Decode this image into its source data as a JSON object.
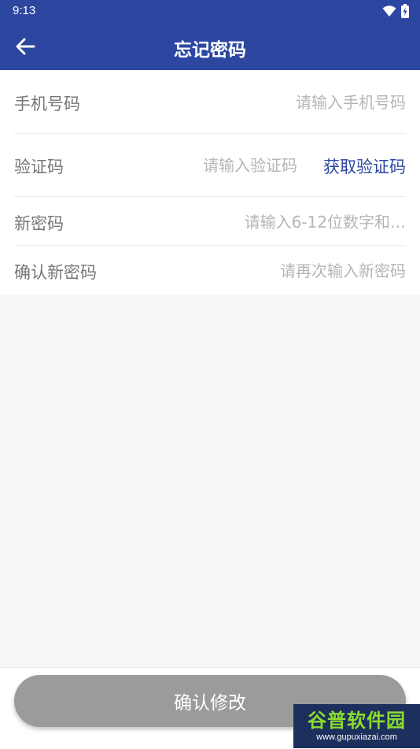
{
  "status_bar": {
    "time": "9:13"
  },
  "header": {
    "title": "忘记密码"
  },
  "form": {
    "phone": {
      "label": "手机号码",
      "placeholder": "请输入手机号码",
      "value": ""
    },
    "code": {
      "label": "验证码",
      "placeholder": "请输入验证码",
      "value": "",
      "get_code_label": "获取验证码"
    },
    "new_password": {
      "label": "新密码",
      "placeholder": "请输入6-12位数字和…",
      "value": ""
    },
    "confirm_password": {
      "label": "确认新密码",
      "placeholder": "请再次输入新密码",
      "value": ""
    }
  },
  "submit": {
    "label": "确认修改"
  },
  "watermark": {
    "title": "谷普软件园",
    "url": "www.gupuxiazai.com"
  },
  "colors": {
    "primary": "#2d47a1",
    "button_disabled": "#9b9b9b",
    "label": "#777777",
    "placeholder": "#b5b5b5"
  },
  "icons": {
    "back": "arrow-left-icon",
    "wifi": "wifi-icon",
    "battery": "battery-charging-icon"
  }
}
